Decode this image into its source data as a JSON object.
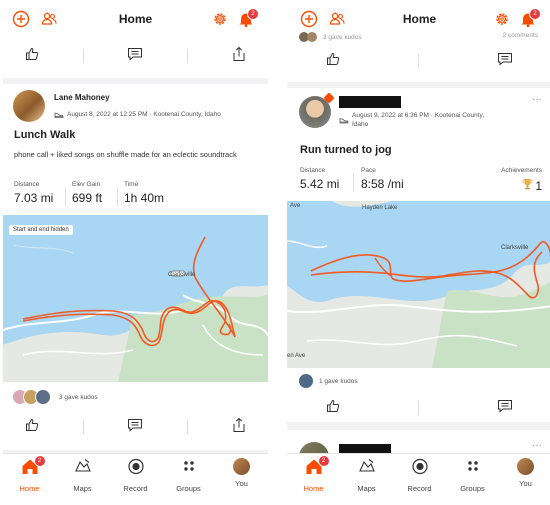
{
  "colors": {
    "accent": "#fc4c02",
    "badge": "#e8393d",
    "route": "#f15a24",
    "water": "#a7d3f0"
  },
  "header": {
    "title": "Home",
    "notification_count": "2"
  },
  "left": {
    "top_card": {
      "icons": [
        "thumbs-up-icon",
        "comment-icon",
        "share-icon"
      ]
    },
    "post": {
      "athlete": "Lane Mahoney",
      "meta": "August 8, 2022 at 12:25 PM · Kootenai County, Idaho",
      "title": "Lunch Walk",
      "description": "phone call + liked songs on shuffle made for an eclectic soundtrack",
      "stats": [
        {
          "label": "Distance",
          "value": "7.03 mi"
        },
        {
          "label": "Elev Gain",
          "value": "699 ft"
        },
        {
          "label": "Time",
          "value": "1h 40m"
        }
      ],
      "map_overlay": "Start and end hidden",
      "map_place": "Clarksville",
      "kudos": "3 gave kudos"
    }
  },
  "right": {
    "top_card": {
      "kudos_fragment": "3 gave kudos",
      "comments_fragment": "2 comments"
    },
    "post": {
      "athlete_name": "",
      "meta": "August 9, 2022 at 6:36 PM · Kootenai County, Idaho",
      "title": "Run turned to jog",
      "stats": [
        {
          "label": "Distance",
          "value": "5.42 mi"
        },
        {
          "label": "Pace",
          "value": "8:58 /mi"
        }
      ],
      "achievements_label": "Achievements",
      "achievements_value": "1",
      "map_places": {
        "lake": "Hayden Lake",
        "town": "Clarksville",
        "road_top": "Ave",
        "road_bottom": "en Ave"
      },
      "kudos": "1 gave kudos"
    }
  },
  "tabs": [
    {
      "label": "Home",
      "icon": "home-icon"
    },
    {
      "label": "Maps",
      "icon": "maps-icon"
    },
    {
      "label": "Record",
      "icon": "record-icon"
    },
    {
      "label": "Groups",
      "icon": "groups-icon"
    },
    {
      "label": "You",
      "icon": "you-avatar"
    }
  ],
  "tab_badge": "2"
}
